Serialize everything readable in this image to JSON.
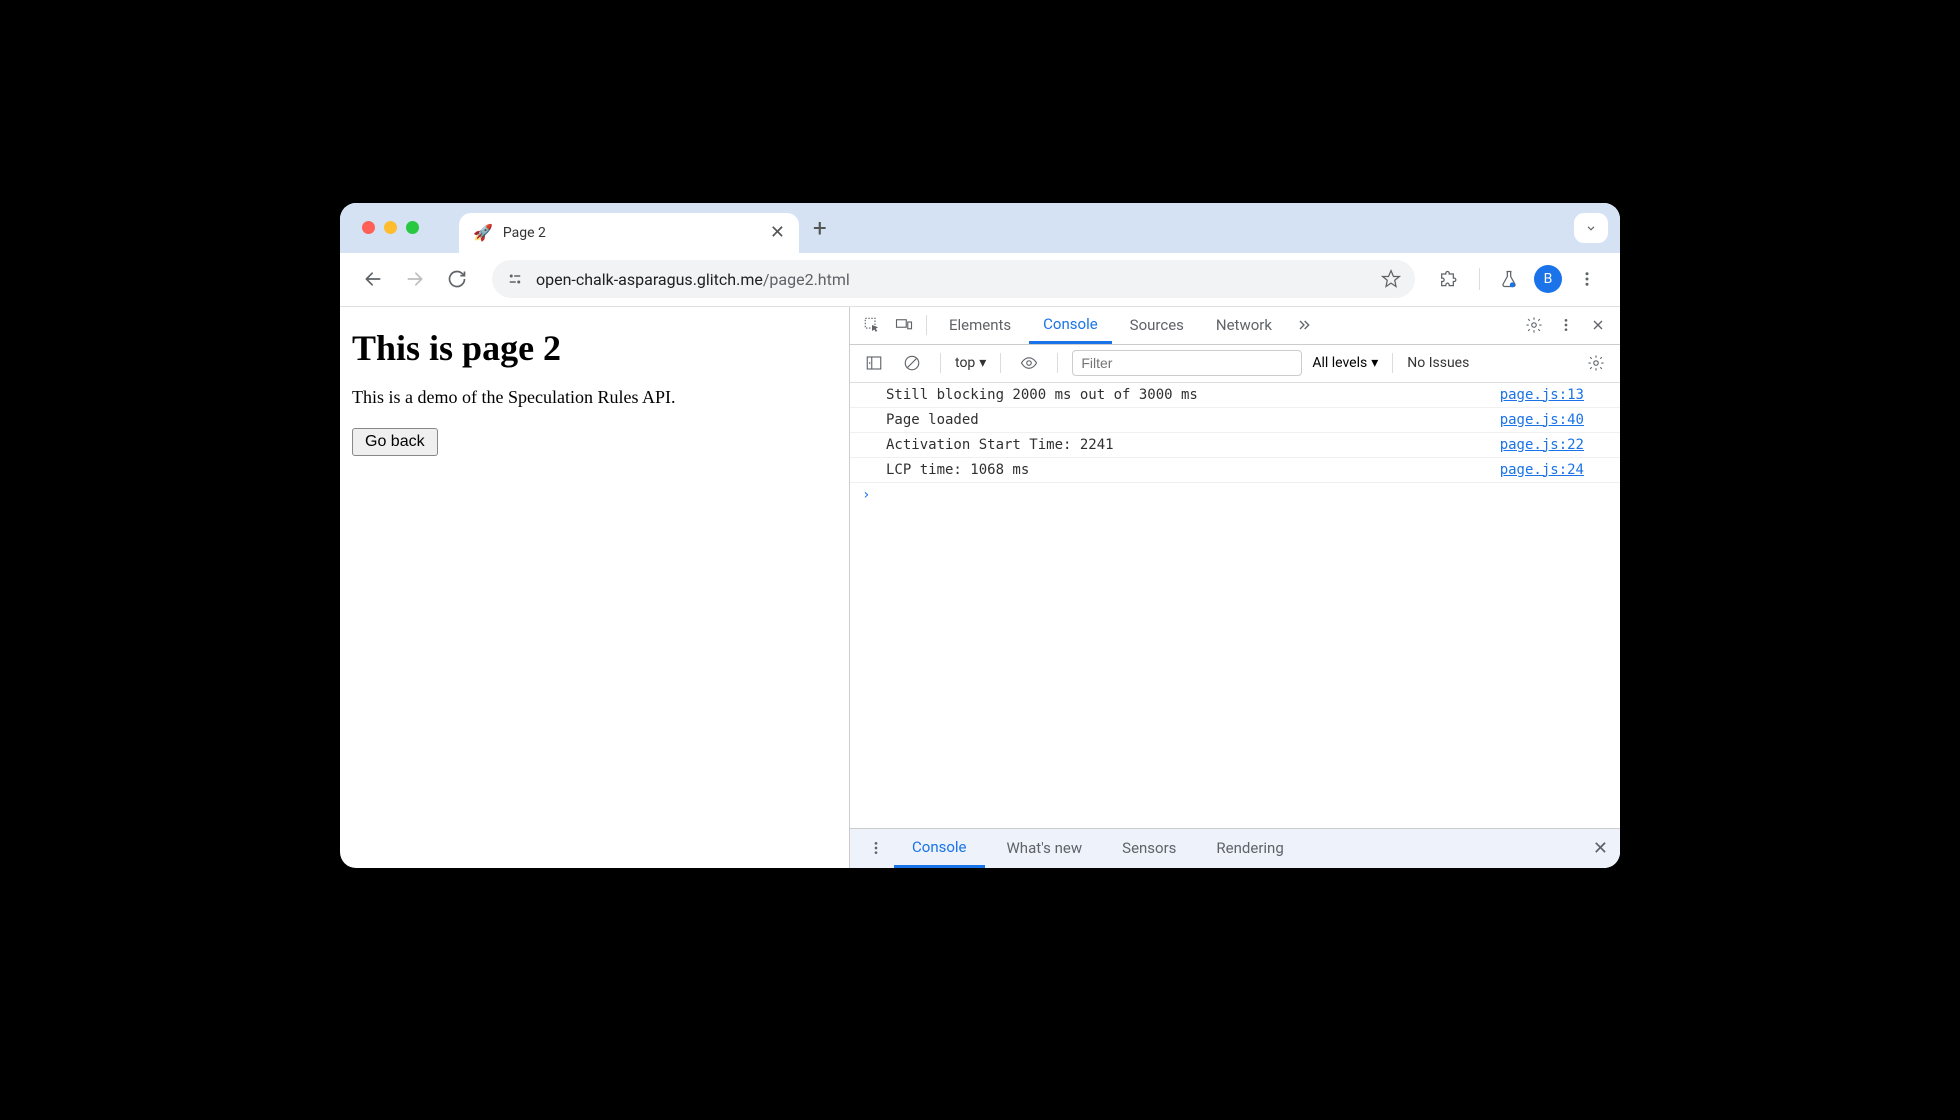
{
  "browser": {
    "tab_title": "Page 2",
    "url_host": "open-chalk-asparagus.glitch.me",
    "url_path": "/page2.html",
    "avatar_letter": "B"
  },
  "page": {
    "heading": "This is page 2",
    "description": "This is a demo of the Speculation Rules API.",
    "go_back_label": "Go back"
  },
  "devtools": {
    "tabs": {
      "elements": "Elements",
      "console": "Console",
      "sources": "Sources",
      "network": "Network"
    },
    "console_toolbar": {
      "context": "top",
      "filter_placeholder": "Filter",
      "levels": "All levels",
      "issues": "No Issues"
    },
    "logs": [
      {
        "msg": "Still blocking 2000 ms out of 3000 ms",
        "src": "page.js:13"
      },
      {
        "msg": "Page loaded",
        "src": "page.js:40"
      },
      {
        "msg": "Activation Start Time: 2241",
        "src": "page.js:22"
      },
      {
        "msg": "LCP time: 1068 ms",
        "src": "page.js:24"
      }
    ],
    "drawer": {
      "console": "Console",
      "whats_new": "What's new",
      "sensors": "Sensors",
      "rendering": "Rendering"
    }
  }
}
